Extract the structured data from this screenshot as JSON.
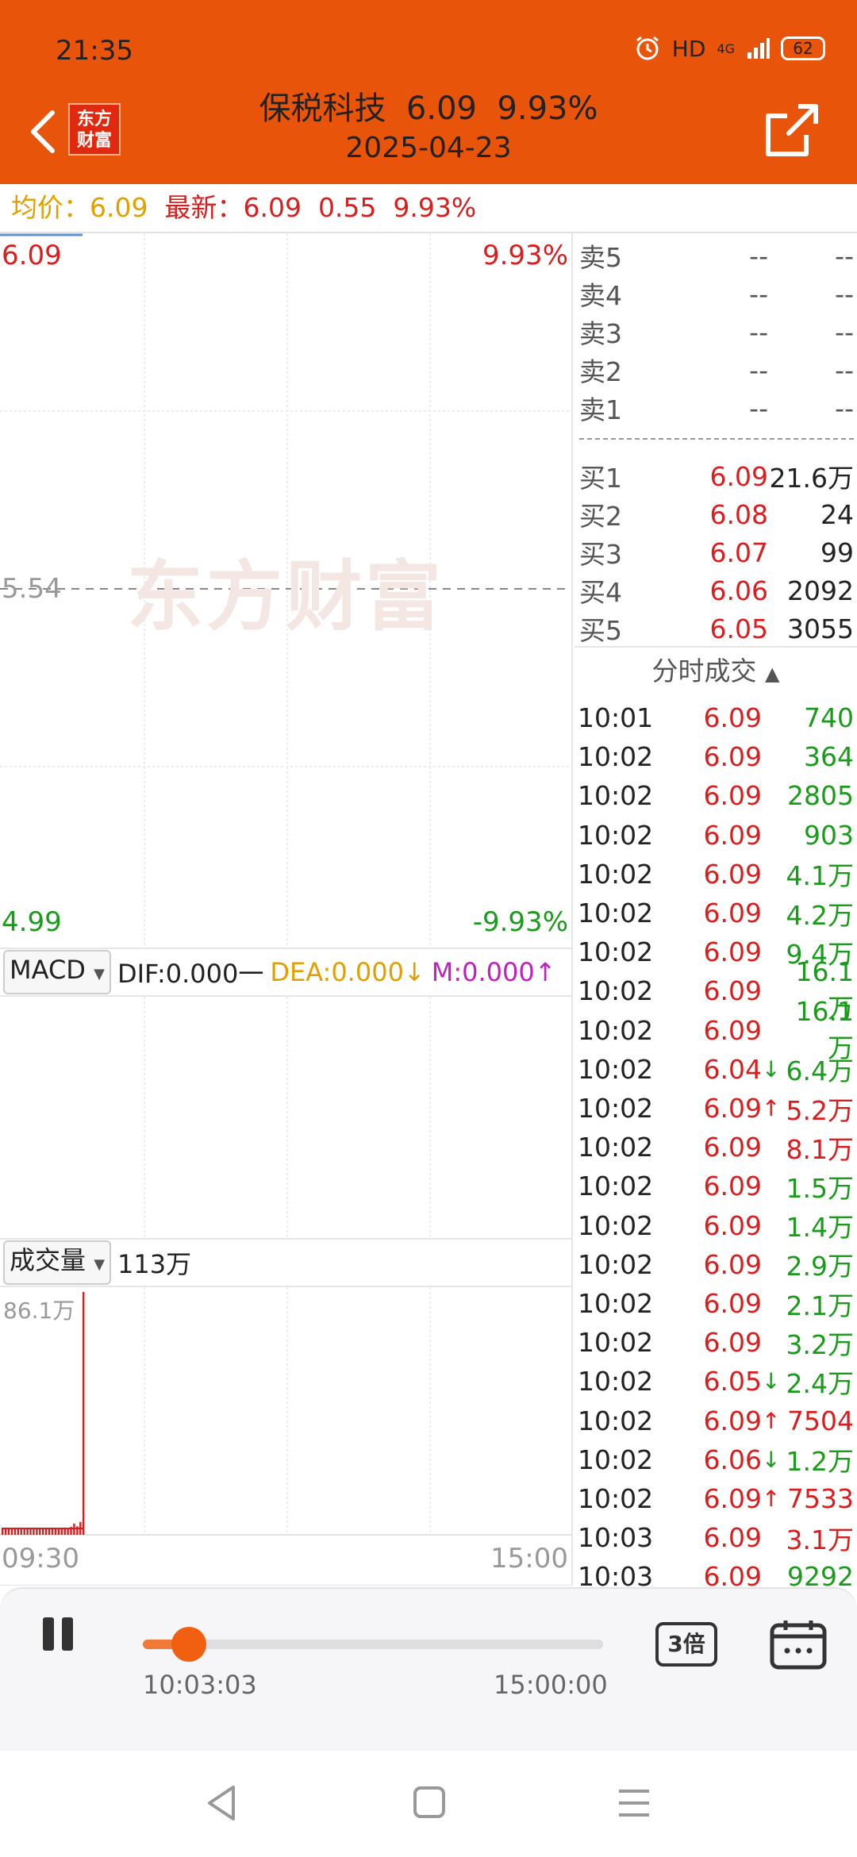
{
  "status": {
    "time": "21:35",
    "hd": "HD",
    "net": "4G",
    "battery": "62"
  },
  "header": {
    "logo_line1": "东方",
    "logo_line2": "财富",
    "title": "保税科技  6.09  9.93%",
    "date": "2025-04-23"
  },
  "avgbar": {
    "avg_label": "均价：",
    "avg_value": "6.09",
    "latest_label": "最新：",
    "latest_value": "6.09",
    "change": "0.55",
    "pct": "9.93%"
  },
  "chart": {
    "price_high": "6.09",
    "pct_high": "9.93%",
    "price_mid": "5.54",
    "price_low": "4.99",
    "pct_low": "-9.93%",
    "watermark": "东方财富",
    "time_start": "09:30",
    "time_end": "15:00",
    "colors": {
      "up": "#d81e1e",
      "down": "#1b9b1b",
      "grid": "#e4e4e4"
    }
  },
  "chart_data": {
    "type": "bar",
    "title": "",
    "series": [
      {
        "values": [
          20000,
          21000,
          20000,
          22000,
          21000,
          20000,
          22000,
          20000,
          23000,
          21000,
          22000,
          20000,
          24000,
          22000,
          21000,
          25000,
          23000,
          22000,
          24000,
          23000,
          26000,
          25000,
          28000,
          40000,
          30000,
          45000,
          861000
        ]
      }
    ],
    "ylim": [
      0,
      861000
    ],
    "ymax_label": "86.1万",
    "x_start": "09:30",
    "x_end": "15:00"
  },
  "macd": {
    "selector": "MACD",
    "dif": "DIF:0.000",
    "dif_mark": "一",
    "dea": "DEA:0.000",
    "dea_mark": "↓",
    "m": "M:0.000",
    "m_mark": "↑"
  },
  "volume": {
    "selector": "成交量",
    "total": "113万",
    "max_label": "86.1万"
  },
  "orderbook": {
    "sells": [
      {
        "label": "卖5",
        "price": "--",
        "vol": "--"
      },
      {
        "label": "卖4",
        "price": "--",
        "vol": "--"
      },
      {
        "label": "卖3",
        "price": "--",
        "vol": "--"
      },
      {
        "label": "卖2",
        "price": "--",
        "vol": "--"
      },
      {
        "label": "卖1",
        "price": "--",
        "vol": "--"
      }
    ],
    "buys": [
      {
        "label": "买1",
        "price": "6.09",
        "vol": "21.6万"
      },
      {
        "label": "买2",
        "price": "6.08",
        "vol": "24"
      },
      {
        "label": "买3",
        "price": "6.07",
        "vol": "99"
      },
      {
        "label": "买4",
        "price": "6.06",
        "vol": "2092"
      },
      {
        "label": "买5",
        "price": "6.05",
        "vol": "3055"
      }
    ]
  },
  "trades": {
    "header": "分时成交",
    "header_icon": "triangle-up-icon",
    "rows": [
      {
        "time": "10:01",
        "price": "6.09",
        "arrow": "",
        "vol": "740",
        "dir": "down"
      },
      {
        "time": "10:02",
        "price": "6.09",
        "arrow": "",
        "vol": "364",
        "dir": "down"
      },
      {
        "time": "10:02",
        "price": "6.09",
        "arrow": "",
        "vol": "2805",
        "dir": "down"
      },
      {
        "time": "10:02",
        "price": "6.09",
        "arrow": "",
        "vol": "903",
        "dir": "down"
      },
      {
        "time": "10:02",
        "price": "6.09",
        "arrow": "",
        "vol": "4.1万",
        "dir": "down"
      },
      {
        "time": "10:02",
        "price": "6.09",
        "arrow": "",
        "vol": "4.2万",
        "dir": "down"
      },
      {
        "time": "10:02",
        "price": "6.09",
        "arrow": "",
        "vol": "9.4万",
        "dir": "down"
      },
      {
        "time": "10:02",
        "price": "6.09",
        "arrow": "",
        "vol": "16.1万",
        "dir": "down"
      },
      {
        "time": "10:02",
        "price": "6.09",
        "arrow": "",
        "vol": "16.1万",
        "dir": "down"
      },
      {
        "time": "10:02",
        "price": "6.04",
        "arrow": "↓",
        "vol": "6.4万",
        "dir": "down"
      },
      {
        "time": "10:02",
        "price": "6.09",
        "arrow": "↑",
        "vol": "5.2万",
        "dir": "up"
      },
      {
        "time": "10:02",
        "price": "6.09",
        "arrow": "",
        "vol": "8.1万",
        "dir": "up"
      },
      {
        "time": "10:02",
        "price": "6.09",
        "arrow": "",
        "vol": "1.5万",
        "dir": "down"
      },
      {
        "time": "10:02",
        "price": "6.09",
        "arrow": "",
        "vol": "1.4万",
        "dir": "down"
      },
      {
        "time": "10:02",
        "price": "6.09",
        "arrow": "",
        "vol": "2.9万",
        "dir": "down"
      },
      {
        "time": "10:02",
        "price": "6.09",
        "arrow": "",
        "vol": "2.1万",
        "dir": "down"
      },
      {
        "time": "10:02",
        "price": "6.09",
        "arrow": "",
        "vol": "3.2万",
        "dir": "down"
      },
      {
        "time": "10:02",
        "price": "6.05",
        "arrow": "↓",
        "vol": "2.4万",
        "dir": "down"
      },
      {
        "time": "10:02",
        "price": "6.09",
        "arrow": "↑",
        "vol": "7504",
        "dir": "up"
      },
      {
        "time": "10:02",
        "price": "6.06",
        "arrow": "↓",
        "vol": "1.2万",
        "dir": "down"
      },
      {
        "time": "10:02",
        "price": "6.09",
        "arrow": "↑",
        "vol": "7533",
        "dir": "up"
      },
      {
        "time": "10:03",
        "price": "6.09",
        "arrow": "",
        "vol": "3.1万",
        "dir": "up"
      },
      {
        "time": "10:03",
        "price": "6.09",
        "arrow": "",
        "vol": "9292",
        "dir": "down"
      }
    ]
  },
  "playback": {
    "current": "10:03:03",
    "end": "15:00:00",
    "progress": 0.1,
    "speed": "3倍"
  }
}
